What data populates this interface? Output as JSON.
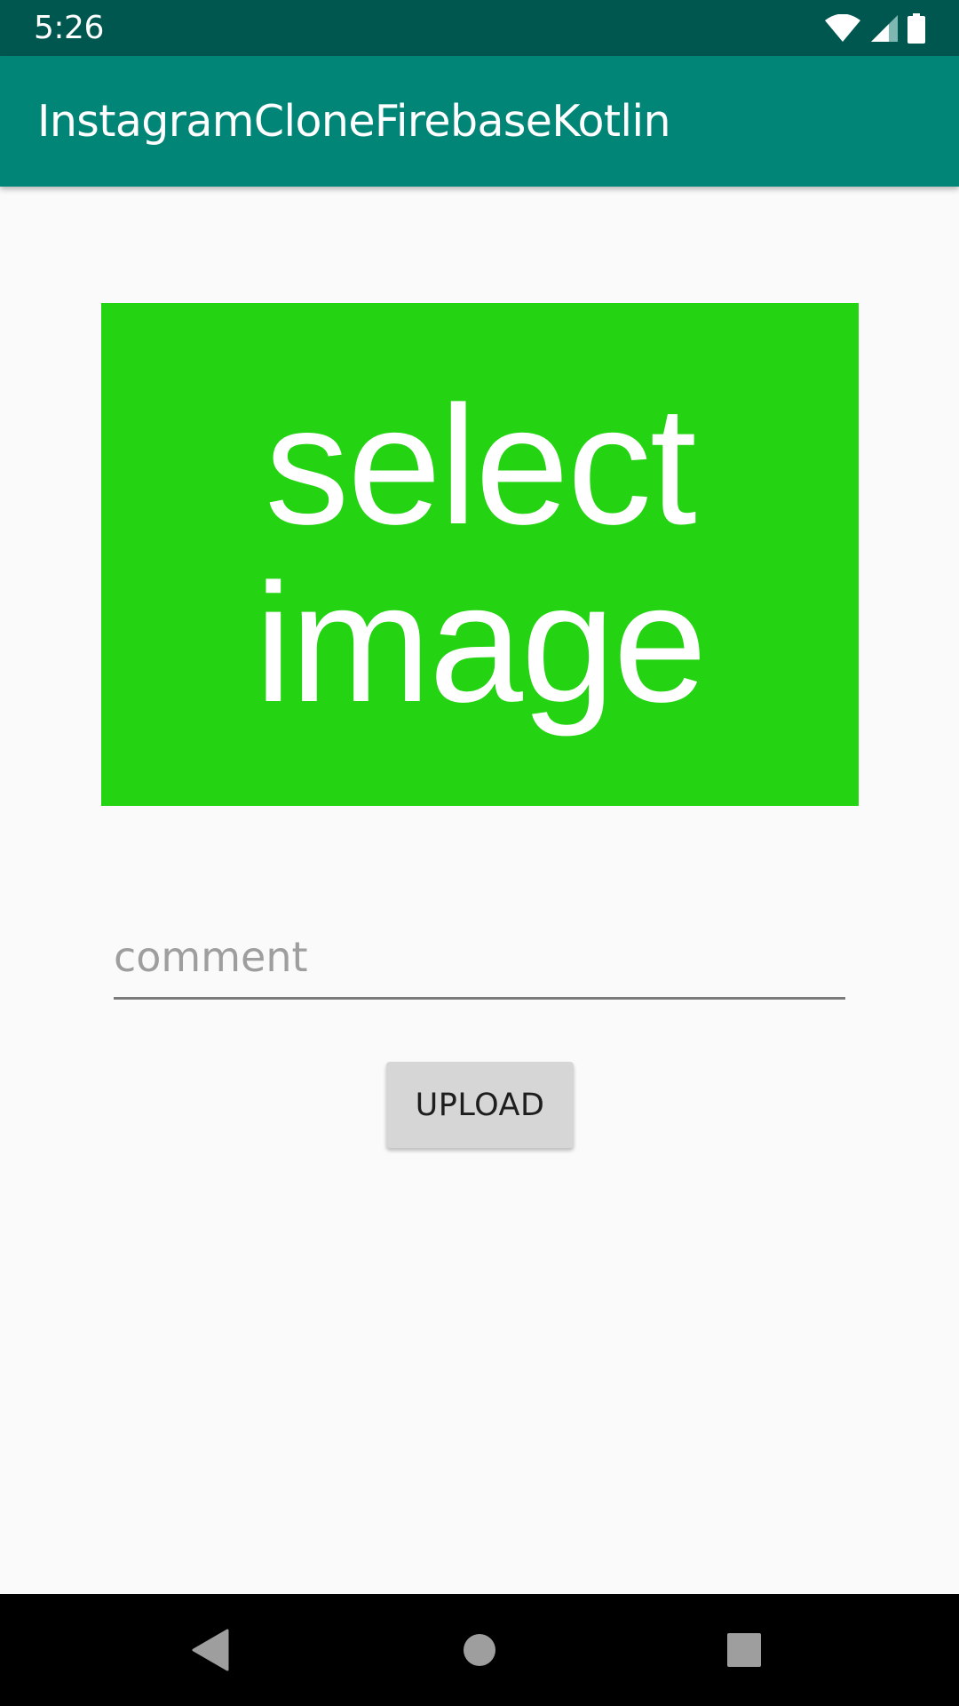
{
  "status_bar": {
    "time": "5:26",
    "icons": [
      "wifi-icon",
      "cell-signal-icon",
      "battery-icon"
    ]
  },
  "app_bar": {
    "title": "InstagramCloneFirebaseKotlin"
  },
  "main": {
    "select_image": {
      "line1": "select",
      "line2": "image",
      "color": "#24d311"
    },
    "comment_field": {
      "placeholder": "comment",
      "value": ""
    },
    "upload_button": {
      "label": "UPLOAD"
    }
  },
  "nav_bar": {
    "buttons": [
      "back-icon",
      "home-icon",
      "recents-icon"
    ]
  },
  "colors": {
    "status_bar": "#00574f",
    "primary": "#008577",
    "background": "#fafafa"
  }
}
